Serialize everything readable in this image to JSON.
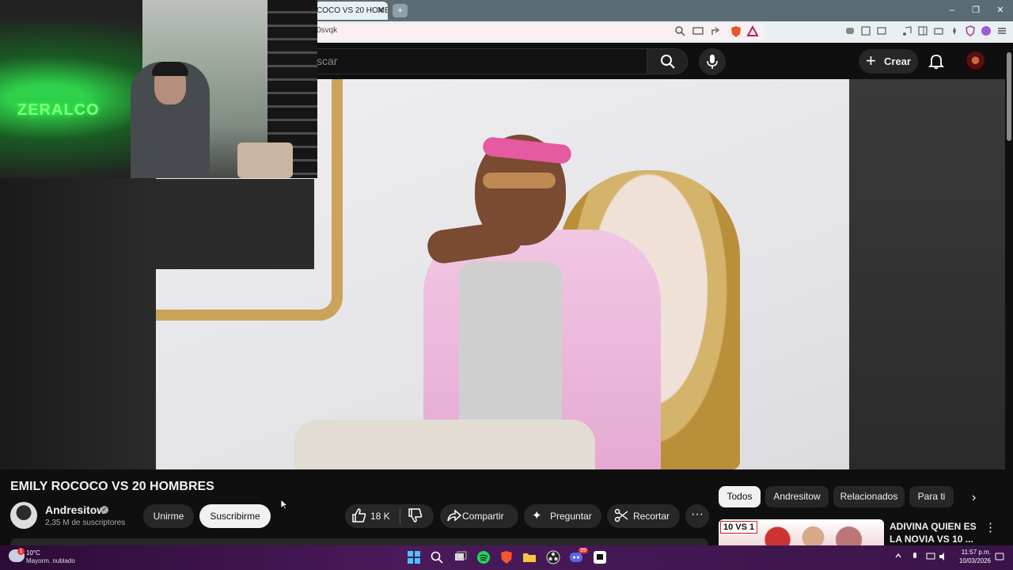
{
  "browser": {
    "tab_title": "COCO VS 20 HOMB",
    "tab_close": "✕",
    "new_tab": "+",
    "url": "0svqk",
    "window_controls": [
      "–",
      "❐",
      "✕"
    ]
  },
  "youtube_header": {
    "search_placeholder": "scar",
    "create_label": "Crear",
    "create_plus": "+"
  },
  "webcam": {
    "logo_text": "ZERALCO"
  },
  "video": {
    "title": "EMILY ROCOCO VS 20 HOMBRES",
    "channel_name": "Andresitow",
    "verified_mark": "✓",
    "subscribers": "2,35 M de suscriptores",
    "join_label": "Unirme",
    "subscribe_label": "Suscribirme",
    "like_count": "18 K",
    "share_label": "Compartir",
    "ask_label": "Preguntar",
    "ask_icon": "✦",
    "clip_label": "Recortar",
    "more_label": "···"
  },
  "filter_chips": {
    "all": "Todos",
    "channel": "Andresitow",
    "related": "Relacionados",
    "for_you": "Para ti",
    "next": "›"
  },
  "recommendation": {
    "badge": "10 VS 1",
    "title": "ADIVINA QUIEN ES LA NOVIA VS 10 ...",
    "more": "⋮"
  },
  "taskbar": {
    "weather_badge": "1",
    "temperature": "10°C",
    "weather_desc": "Mayorm. nublado",
    "time": "11:57 p.m.",
    "date": "10/03/2026",
    "discord_badge": "99"
  },
  "colors": {
    "yt_bg": "#0f0f0f",
    "chip_active": "#f1f1f1",
    "subscribe_bg": "#f1f1f1",
    "taskbar": "#3a1448",
    "browser_tabbar": "#5c6c74"
  }
}
